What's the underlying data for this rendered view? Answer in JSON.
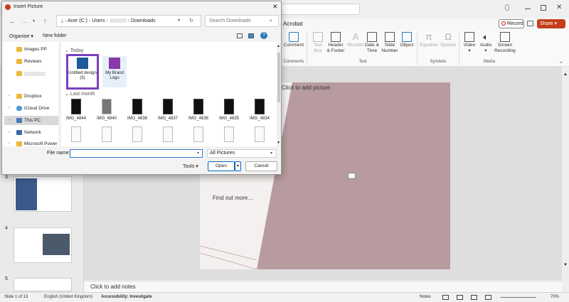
{
  "dialog": {
    "title": "Insert Picture",
    "breadcrumb": [
      "Acer (C:)",
      "Users",
      "Downloads"
    ],
    "search_placeholder": "Search Downloads",
    "organise": "Organise",
    "new_folder": "New folder",
    "sidebar": [
      {
        "label": "Images PP",
        "icon": "folder"
      },
      {
        "label": "Reviews",
        "icon": "folder"
      },
      {
        "label": "",
        "icon": "folder"
      },
      {
        "label": "Dropbox",
        "icon": "folder"
      },
      {
        "label": "iCloud Drive",
        "icon": "cloud"
      },
      {
        "label": "This PC",
        "icon": "pc"
      },
      {
        "label": "Network",
        "icon": "network"
      },
      {
        "label": "Microsoft Power",
        "icon": "folder"
      }
    ],
    "group_today": "Today",
    "group_last_month": "Last month",
    "today_files": [
      "Untitled design (5)",
      "My Brand Logo"
    ],
    "month_files": [
      "IMG_4844",
      "IMG_4840",
      "IMG_4838",
      "IMG_4837",
      "IMG_4836",
      "IMG_4835",
      "IMG_4834"
    ],
    "file_name_label": "File name:",
    "file_name_value": "",
    "file_type": "All Pictures",
    "tools": "Tools",
    "open": "Open",
    "cancel": "Cancel"
  },
  "ribbon": {
    "tab_acrobat": "Acrobat",
    "record": "Record",
    "share": "Share",
    "buttons": {
      "comment": "Comment",
      "text_box": "Text Box",
      "header_footer": "Header & Footer",
      "wordart": "WordArt",
      "date_time": "Date & Time",
      "slide_number": "Slide Number",
      "object": "Object",
      "equation": "Equation",
      "symbol": "Symbol",
      "video": "Video",
      "audio": "Audio",
      "screen_recording": "Screen Recording"
    },
    "groups": {
      "comments": "Comments",
      "text": "Text",
      "symbols": "Symbols",
      "media": "Media"
    }
  },
  "slide": {
    "placeholder": "Click to add picture",
    "find_out": "Find out more…"
  },
  "thumbnails": [
    {
      "number": "3"
    },
    {
      "number": "4"
    },
    {
      "number": "5"
    }
  ],
  "notes_placeholder": "Click to add notes",
  "status": {
    "slide": "Slide 1 of 13",
    "language": "English (United Kingdom)",
    "accessibility": "Accessibility: Investigate",
    "notes": "Notes",
    "zoom": "70%"
  }
}
